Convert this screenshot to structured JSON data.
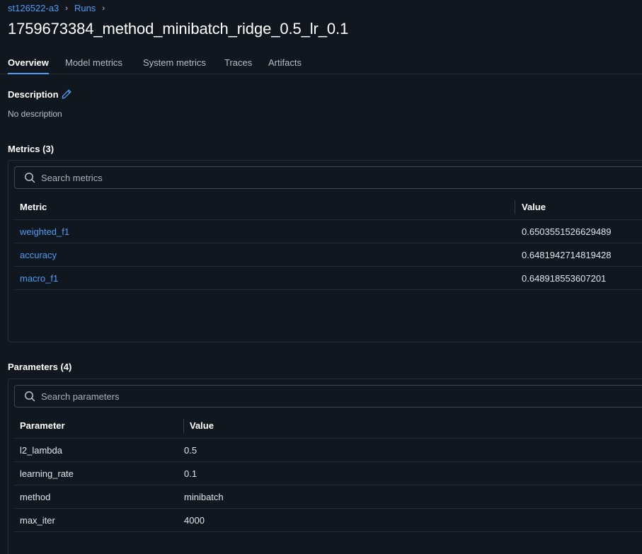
{
  "breadcrumb": {
    "experiment": "st126522-a3",
    "runs": "Runs",
    "separator": "›"
  },
  "page_title": "1759673384_method_minibatch_ridge_0.5_lr_0.1",
  "tabs": [
    {
      "label": "Overview",
      "active": true
    },
    {
      "label": "Model metrics",
      "active": false
    },
    {
      "label": "System metrics",
      "active": false
    },
    {
      "label": "Traces",
      "active": false
    },
    {
      "label": "Artifacts",
      "active": false
    }
  ],
  "description": {
    "heading": "Description",
    "text": "No description",
    "edit_icon": "pencil-icon"
  },
  "metrics": {
    "heading": "Metrics (3)",
    "search_placeholder": "Search metrics",
    "columns": [
      "Metric",
      "Value"
    ],
    "rows": [
      {
        "name": "weighted_f1",
        "value": "0.6503551526629489"
      },
      {
        "name": "accuracy",
        "value": "0.6481942714819428"
      },
      {
        "name": "macro_f1",
        "value": "0.648918553607201"
      }
    ]
  },
  "parameters": {
    "heading": "Parameters (4)",
    "search_placeholder": "Search parameters",
    "columns": [
      "Parameter",
      "Value"
    ],
    "rows": [
      {
        "name": "l2_lambda",
        "value": "0.5"
      },
      {
        "name": "learning_rate",
        "value": "0.1"
      },
      {
        "name": "method",
        "value": "minibatch"
      },
      {
        "name": "max_iter",
        "value": "4000"
      }
    ]
  },
  "colors": {
    "background": "#11171f",
    "link": "#4f9cf5",
    "border": "#252d38",
    "text": "#e2e6eb"
  }
}
